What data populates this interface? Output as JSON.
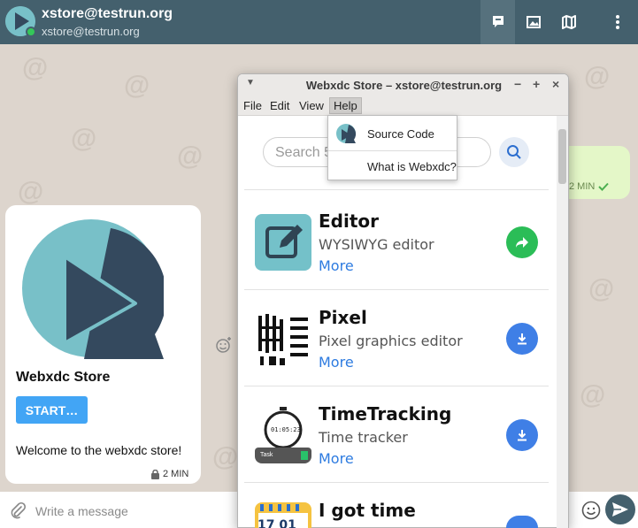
{
  "header": {
    "title": "xstore@testrun.org",
    "subtitle": "xstore@testrun.org",
    "icons": [
      "apps-icon",
      "gallery-icon",
      "map-icon",
      "more-vert-icon"
    ]
  },
  "chat": {
    "incoming": {
      "name": "Webxdc Store",
      "button": "START…",
      "text": "Welcome to the webxdc store!",
      "time": "2 MIN"
    },
    "outgoing": {
      "time": "2 MIN"
    },
    "composer": {
      "placeholder": "Write a message"
    }
  },
  "window": {
    "title": "Webxdc Store – xstore@testrun.org",
    "menu": [
      "File",
      "Edit",
      "View",
      "Help"
    ],
    "help_menu": {
      "items": [
        {
          "label": "Source Code",
          "icon": "webxdc-logo-icon"
        },
        {
          "label": "What is Webxdc?"
        }
      ]
    },
    "search": {
      "placeholder": "Search 5"
    },
    "apps": [
      {
        "name": "Editor",
        "desc": "WYSIWYG editor",
        "more": "More",
        "action": "open",
        "action_color": "#2bbd57"
      },
      {
        "name": "Pixel",
        "desc": "Pixel graphics editor",
        "more": "More",
        "action": "download",
        "action_color": "#3f7fe6"
      },
      {
        "name": "TimeTracking",
        "desc": "Time tracker",
        "more": "More",
        "action": "download",
        "action_color": "#3f7fe6",
        "icon_time": "01:05:23",
        "icon_task": "Task"
      },
      {
        "name": "I got time",
        "desc": "",
        "more": "",
        "action": "download",
        "action_color": "#3f7fe6",
        "icon_date": "17 01"
      }
    ]
  },
  "colors": {
    "header": "#44606d",
    "chat_bg": "#ddd5cd",
    "start_button": "#42a5f5",
    "link": "#2d7be0"
  }
}
